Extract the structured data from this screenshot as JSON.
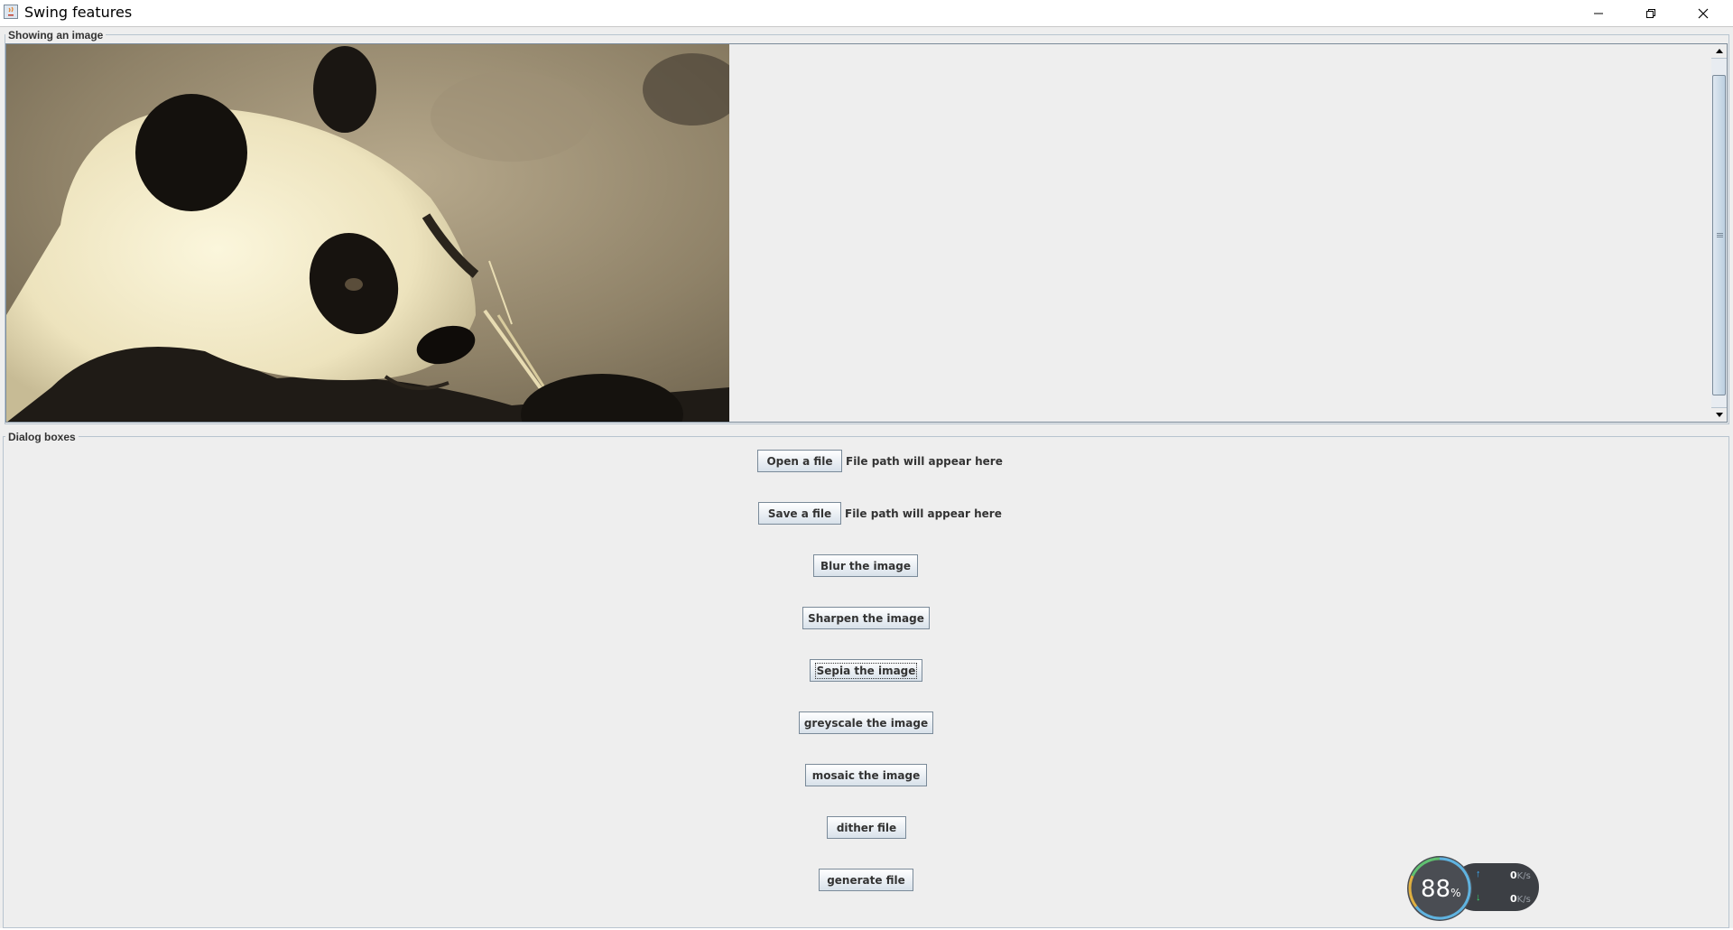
{
  "window": {
    "title": "Swing features",
    "controls": {
      "minimize": "minimize-icon",
      "maximize": "restore-icon",
      "close": "close-icon"
    }
  },
  "image_panel": {
    "title": "Showing an image",
    "image_alt": "panda-photo-sepia"
  },
  "dialog_panel": {
    "title": "Dialog boxes",
    "open_button": "Open a file",
    "open_path": "File path will appear here",
    "save_button": "Save a file",
    "save_path": "File path will appear here",
    "blur_button": "Blur the image",
    "sharpen_button": "Sharpen the image",
    "sepia_button": "Sepia the image",
    "greyscale_button": "greyscale the image",
    "mosaic_button": "mosaic the image",
    "dither_button": "dither file",
    "generate_button": "generate file"
  },
  "net_widget": {
    "cpu_percent": "88",
    "percent_sign": "%",
    "upload": "0",
    "download": "0",
    "unit": "K/s",
    "colors": {
      "up_arrow": "#3ab0ff",
      "down_arrow": "#3adb6a"
    }
  }
}
